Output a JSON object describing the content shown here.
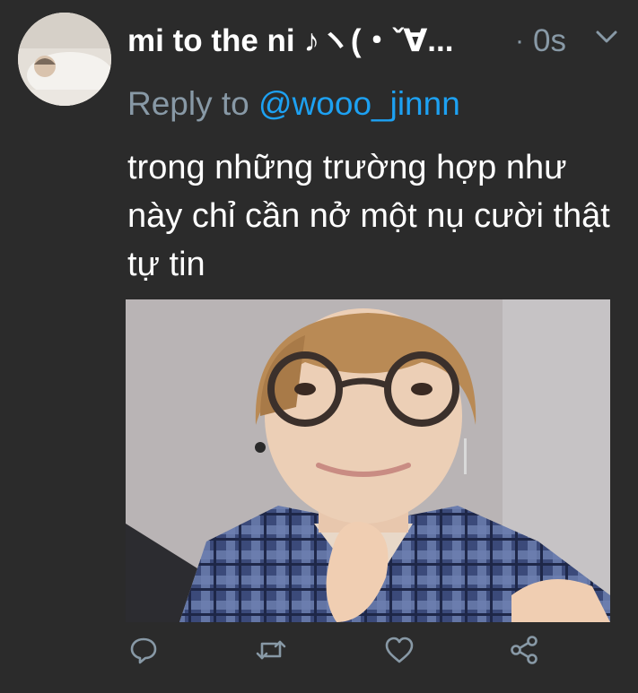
{
  "tweet": {
    "display_name": "mi to the ni ♪ヽ(・ˇ∀...",
    "separator": "·",
    "timestamp": "0s",
    "reply_prefix": "Reply to",
    "reply_handle": "@wooo_jinnn",
    "text": "trong những trường hợp như này chỉ cần nở một nụ cười thật tự tin"
  },
  "icons": {
    "menu": "chevron-down-icon",
    "reply": "reply-icon",
    "retweet": "retweet-icon",
    "like": "heart-icon",
    "share": "share-icon"
  },
  "colors": {
    "background": "#2b2b2b",
    "muted_text": "#8899a6",
    "link": "#1da1f2",
    "text": "#ffffff"
  }
}
